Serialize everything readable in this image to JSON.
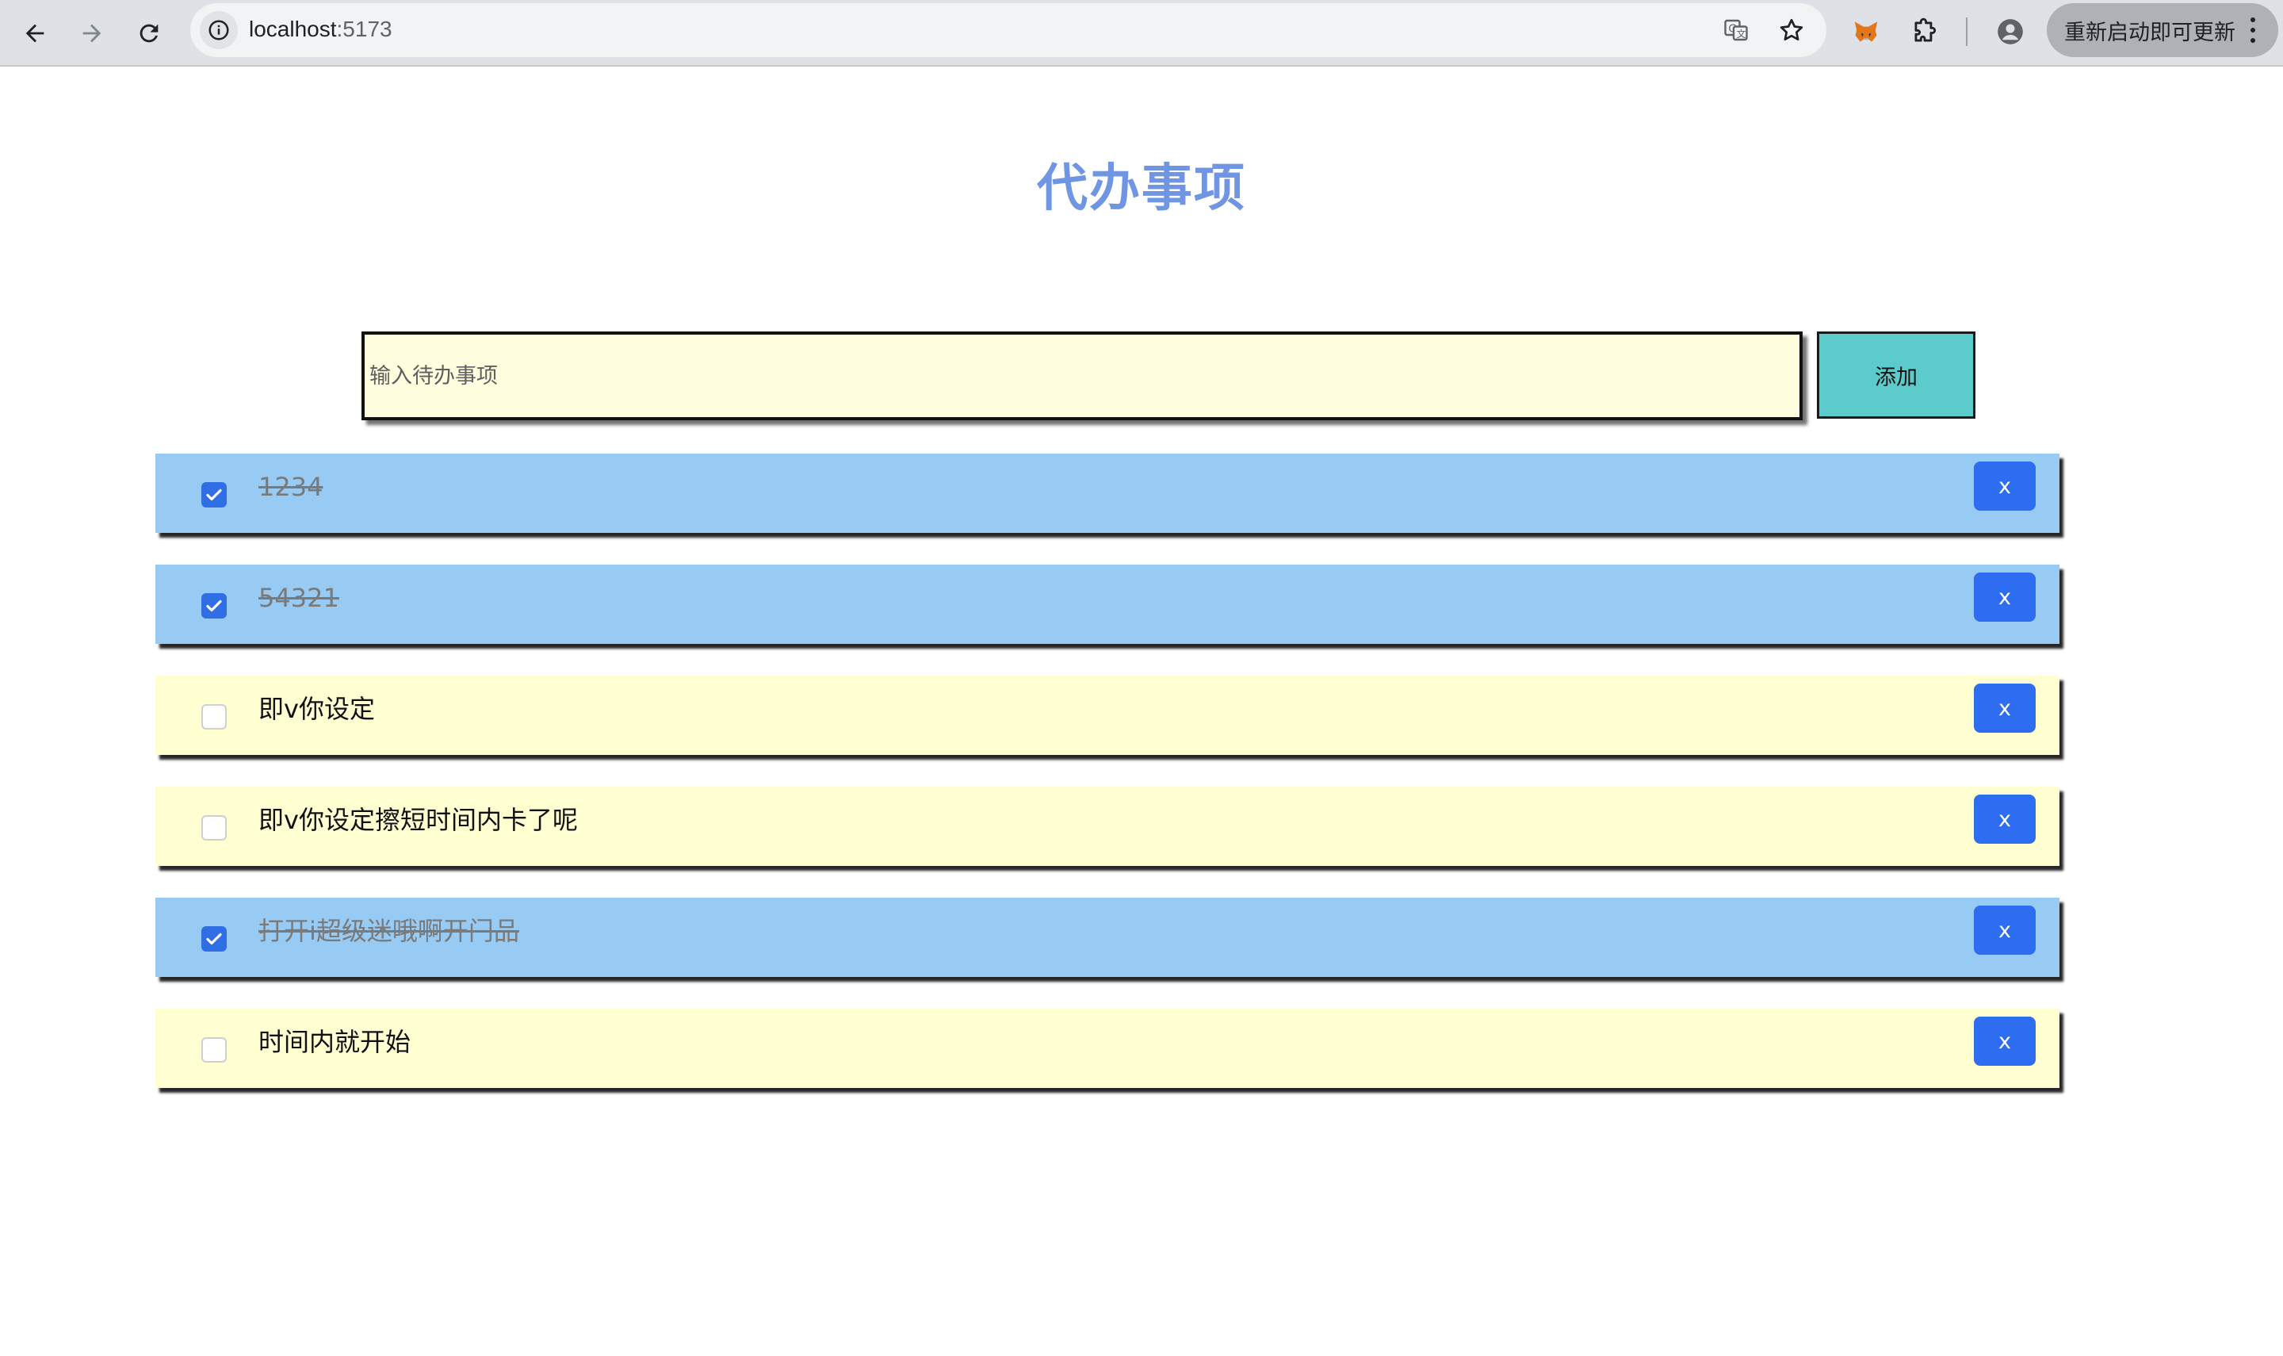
{
  "browser": {
    "url_host": "localhost",
    "url_port": ":5173",
    "update_label": "重新启动即可更新"
  },
  "app": {
    "title": "代办事项",
    "input": {
      "placeholder": "输入待办事项",
      "value": ""
    },
    "add_label": "添加",
    "delete_label": "x",
    "colors": {
      "title": "#6f95e3",
      "done_bg": "#98cbf4",
      "open_bg": "#ffffd2",
      "add_button": "#5ccbcc",
      "delete_button": "#2f6df0",
      "checkbox": "#2f6ee5"
    }
  },
  "todos": [
    {
      "text": "1234",
      "done": true
    },
    {
      "text": "54321",
      "done": true
    },
    {
      "text": "即v你设定",
      "done": false
    },
    {
      "text": "即v你设定擦短时间内卡了呢",
      "done": false
    },
    {
      "text": "打开i超级迷哦啊开门品",
      "done": true
    },
    {
      "text": "时间内就开始",
      "done": false
    }
  ]
}
